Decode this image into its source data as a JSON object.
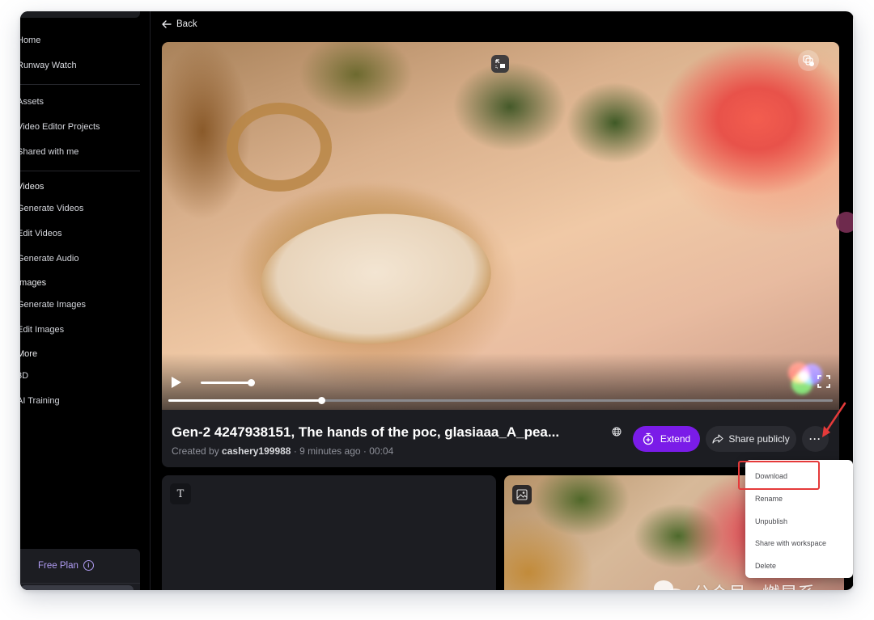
{
  "sidebar": {
    "items": [
      {
        "label": "Home",
        "type": "item"
      },
      {
        "label": "Runway Watch",
        "type": "item"
      },
      {
        "label": "Assets",
        "type": "item"
      },
      {
        "label": "Video Editor Projects",
        "type": "item"
      },
      {
        "label": "Shared with me",
        "type": "item"
      },
      {
        "label": "Videos",
        "type": "section"
      },
      {
        "label": "Generate Videos",
        "type": "item"
      },
      {
        "label": "Edit Videos",
        "type": "item"
      },
      {
        "label": "Generate Audio",
        "type": "item"
      },
      {
        "label": "Images",
        "type": "section"
      },
      {
        "label": "Generate Images",
        "type": "item"
      },
      {
        "label": "Edit Images",
        "type": "item"
      },
      {
        "label": "More",
        "type": "section"
      },
      {
        "label": "3D",
        "type": "item"
      },
      {
        "label": "AI Training",
        "type": "item"
      }
    ],
    "plan": {
      "label": "Free Plan",
      "info_icon": "info-icon"
    }
  },
  "header": {
    "back_label": "Back",
    "back_icon": "arrow-left-icon"
  },
  "player": {
    "volume_percent": 100,
    "progress_percent": 23,
    "icons": [
      "picture-in-picture-icon",
      "copy-to-collection-icon",
      "play-icon",
      "fullscreen-icon",
      "color-adjust-icon"
    ]
  },
  "asset": {
    "title": "Gen-2 4247938151, The hands of the poc, glasiaaa_A_pea...",
    "created_by_prefix": "Created by",
    "author": "cashery199988",
    "time_ago": "9 minutes ago",
    "duration": "00:04",
    "separator": "·",
    "visibility_icon": "globe-icon"
  },
  "actions": {
    "extend_label": "Extend",
    "share_label": "Share publicly",
    "more_label": "···"
  },
  "menu": {
    "items": [
      "Download",
      "Rename",
      "Unpublish",
      "Share with workspace",
      "Delete"
    ],
    "highlighted": "Download"
  },
  "cards": [
    {
      "type": "text",
      "icon_label": "T"
    },
    {
      "type": "image",
      "icon": "image-icon"
    }
  ],
  "watermark": {
    "text": "公众号 · 燃星系"
  },
  "colors": {
    "accent": "#7a1ce8",
    "plan": "#b09cf3",
    "highlight": "#e53a3a"
  }
}
